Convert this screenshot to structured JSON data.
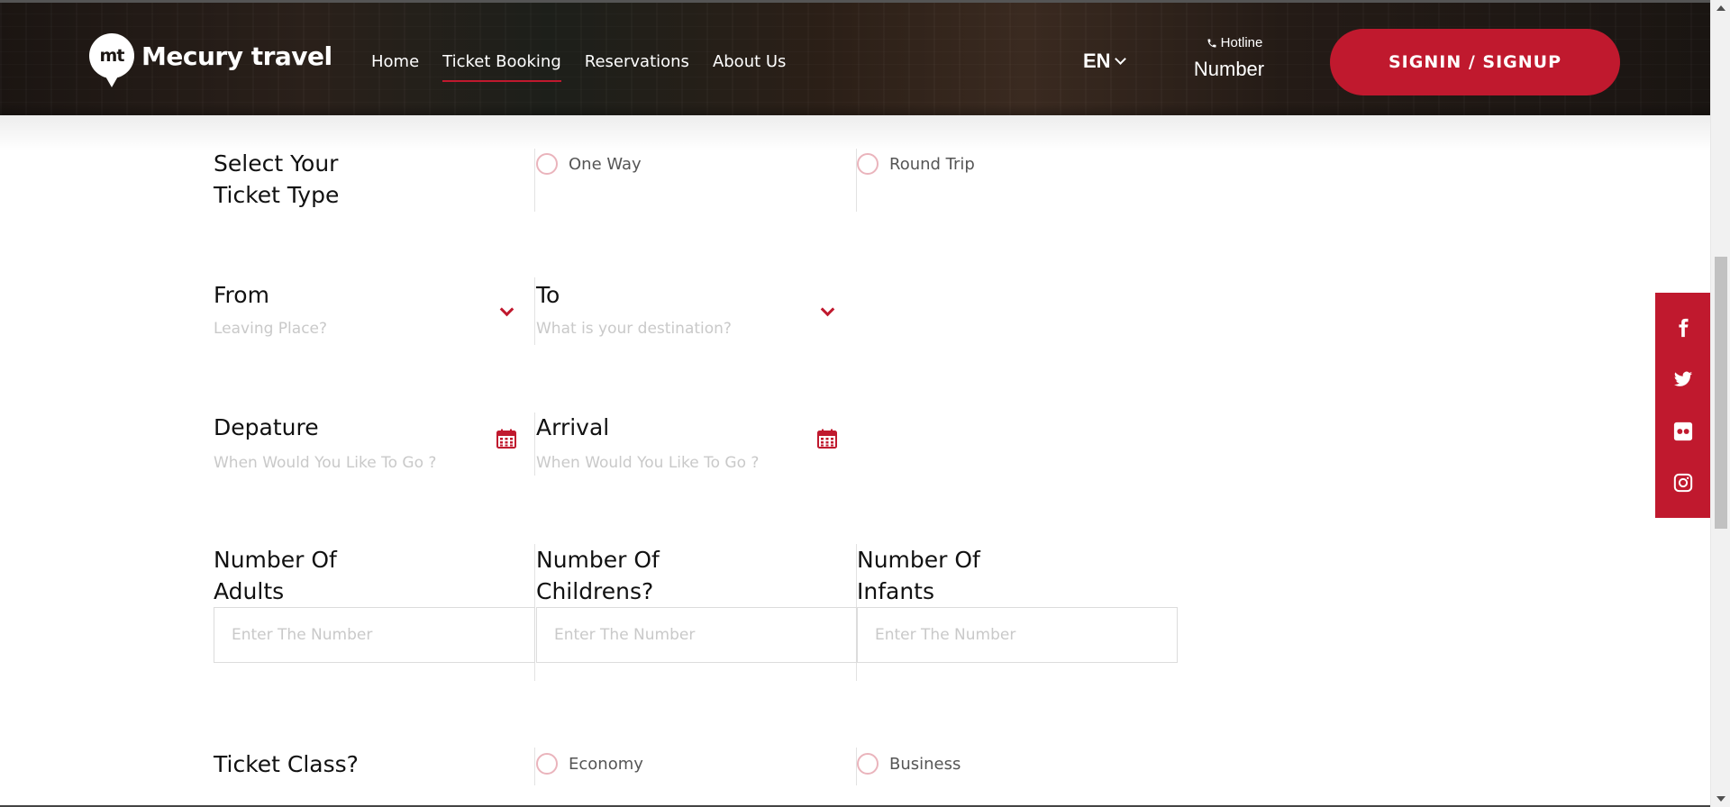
{
  "header": {
    "logo_mark": "mt",
    "logo_text": "Mecury travel",
    "nav": [
      "Home",
      "Ticket Booking",
      "Reservations",
      "About Us"
    ],
    "active_nav": "Ticket Booking",
    "language": "EN",
    "hotline_label": "Hotline",
    "hotline_number": "Number",
    "signin_label": "SIGNIN / SIGNUP"
  },
  "form": {
    "ticket_type": {
      "label_line1": "Select Your",
      "label_line2": "Ticket Type",
      "options": [
        "One Way",
        "Round Trip"
      ]
    },
    "from": {
      "label": "From",
      "placeholder": "Leaving Place?"
    },
    "to": {
      "label": "To",
      "placeholder": "What is your destination?"
    },
    "departure": {
      "label": "Depature",
      "placeholder": "When Would You Like To Go ?"
    },
    "arrival": {
      "label": "Arrival",
      "placeholder": "When Would You Like To Go ?"
    },
    "adults": {
      "label_line1": "Number Of",
      "label_line2": "Adults",
      "placeholder": "Enter The Number"
    },
    "childrens": {
      "label_line1": "Number Of",
      "label_line2": "Childrens?",
      "placeholder": "Enter The Number"
    },
    "infants": {
      "label_line1": "Number Of",
      "label_line2": "Infants",
      "placeholder": "Enter The Number"
    },
    "ticket_class": {
      "label": "Ticket Class?",
      "options": [
        "Economy",
        "Business"
      ]
    }
  },
  "social": [
    "facebook-icon",
    "twitter-icon",
    "flickr-icon",
    "instagram-icon"
  ],
  "colors": {
    "accent": "#c0192e",
    "header_bg": "#221a15",
    "placeholder": "#c9c9c9"
  }
}
